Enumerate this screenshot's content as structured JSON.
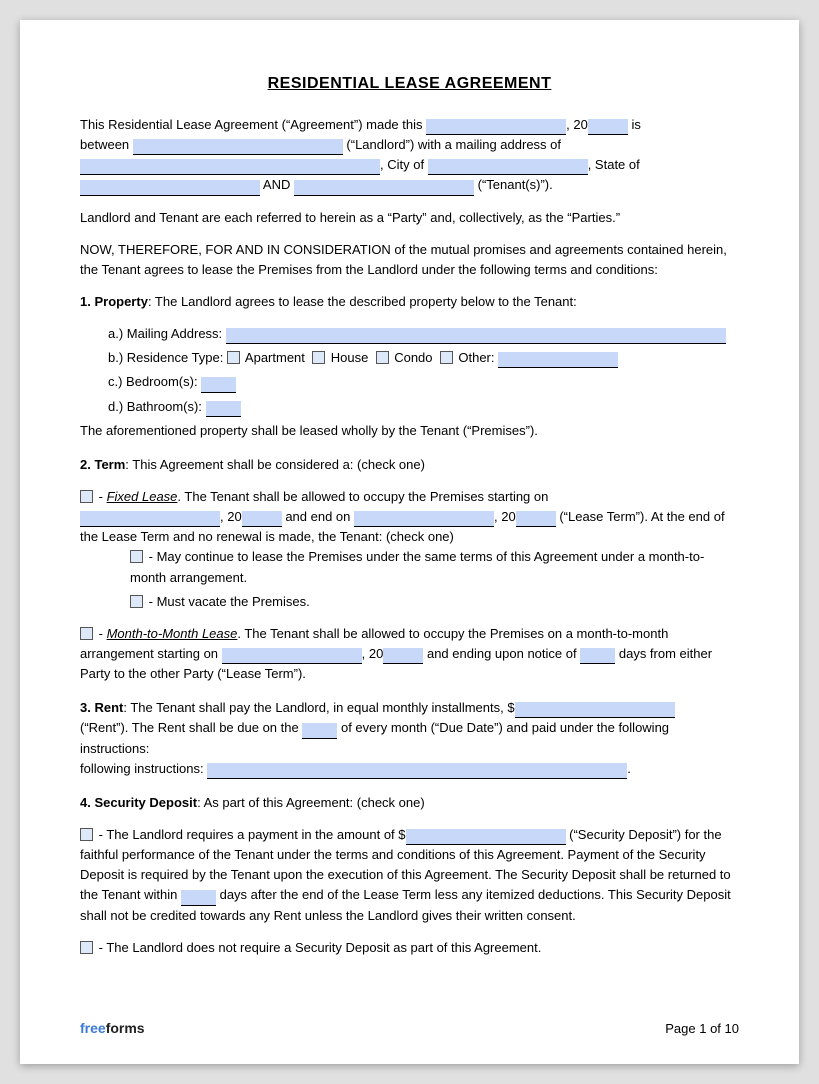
{
  "title": "RESIDENTIAL LEASE AGREEMENT",
  "intro": {
    "line1": "This Residential Lease Agreement (“Agreement”) made this",
    "year_prefix": ", 20",
    "year_suffix": " is",
    "line2_prefix": "between",
    "landlord_suffix": "(“Landlord”) with a mailing address of",
    "city_prefix": ", City of",
    "state_prefix": ", State of",
    "and_label": "AND",
    "tenant_suffix": "(“Tenant(s)”)."
  },
  "party_line": "Landlord and Tenant are each referred to herein as a “Party” and, collectively, as the “Parties.”",
  "consideration": "NOW, THEREFORE, FOR AND IN CONSIDERATION of the mutual promises and agreements contained herein, the Tenant agrees to lease the Premises from the Landlord under the following terms and conditions:",
  "sections": {
    "s1": {
      "number": "1.",
      "title": "Property",
      "text": ": The Landlord agrees to lease the described property below to the Tenant:",
      "items": {
        "a": "a.)  Mailing Address:",
        "b_prefix": "b.)  Residence Type:",
        "b_options": [
          "Apartment",
          "House",
          "Condo",
          "Other:"
        ],
        "c": "c.)  Bedroom(s):",
        "d": "d.)  Bathroom(s):"
      },
      "closing": "The aforementioned property shall be leased wholly by the Tenant (“Premises”)."
    },
    "s2": {
      "number": "2.",
      "title": "Term",
      "text": ": This Agreement shall be considered a: (check one)",
      "fixed_prefix": "- ",
      "fixed_title": "Fixed Lease",
      "fixed_text": ". The Tenant shall be allowed to occupy the Premises starting on",
      "fixed_year1": ", 20",
      "fixed_and": "and end on",
      "fixed_year2": ", 20",
      "fixed_lease_term": "(“Lease Term”). At the end of the Lease Term and no renewal is made, the Tenant: (check one)",
      "fixed_sub1": "- May continue to lease the Premises under the same terms of this Agreement under a month-to-month arrangement.",
      "fixed_sub2": "- Must vacate the Premises.",
      "month_prefix": "- ",
      "month_title": "Month-to-Month Lease",
      "month_text": ". The Tenant shall be allowed to occupy the Premises on a month-to-month arrangement starting on",
      "month_year": ", 20",
      "month_ending": "and ending upon notice of",
      "month_days": "days from either Party to the other Party (“Lease Term”)."
    },
    "s3": {
      "number": "3.",
      "title": "Rent",
      "text": ": The Tenant shall pay the Landlord, in equal monthly installments, $",
      "rent_suffix": "(“Rent”). The Rent shall be due on the",
      "due_suffix": "of every month (“Due Date”) and paid under the following instructions:",
      "instructions_label": ""
    },
    "s4": {
      "number": "4.",
      "title": "Security Deposit",
      "text": ": As part of this Agreement: (check one)",
      "option1_prefix": "- The Landlord requires a payment in the amount of $",
      "option1_suffix": "(“Security Deposit”) for the faithful performance of the Tenant under the terms and conditions of this Agreement. Payment of the Security Deposit is required by the Tenant upon the execution of this Agreement. The Security Deposit shall be returned to the Tenant within",
      "option1_days": "days after the end of the Lease Term less any itemized deductions. This Security Deposit shall not be credited towards any Rent unless the Landlord gives their written consent.",
      "option2": "- The Landlord does not require a Security Deposit as part of this Agreement."
    }
  },
  "footer": {
    "brand_free": "free",
    "brand_forms": "forms",
    "page_label": "Page 1 of 10"
  }
}
